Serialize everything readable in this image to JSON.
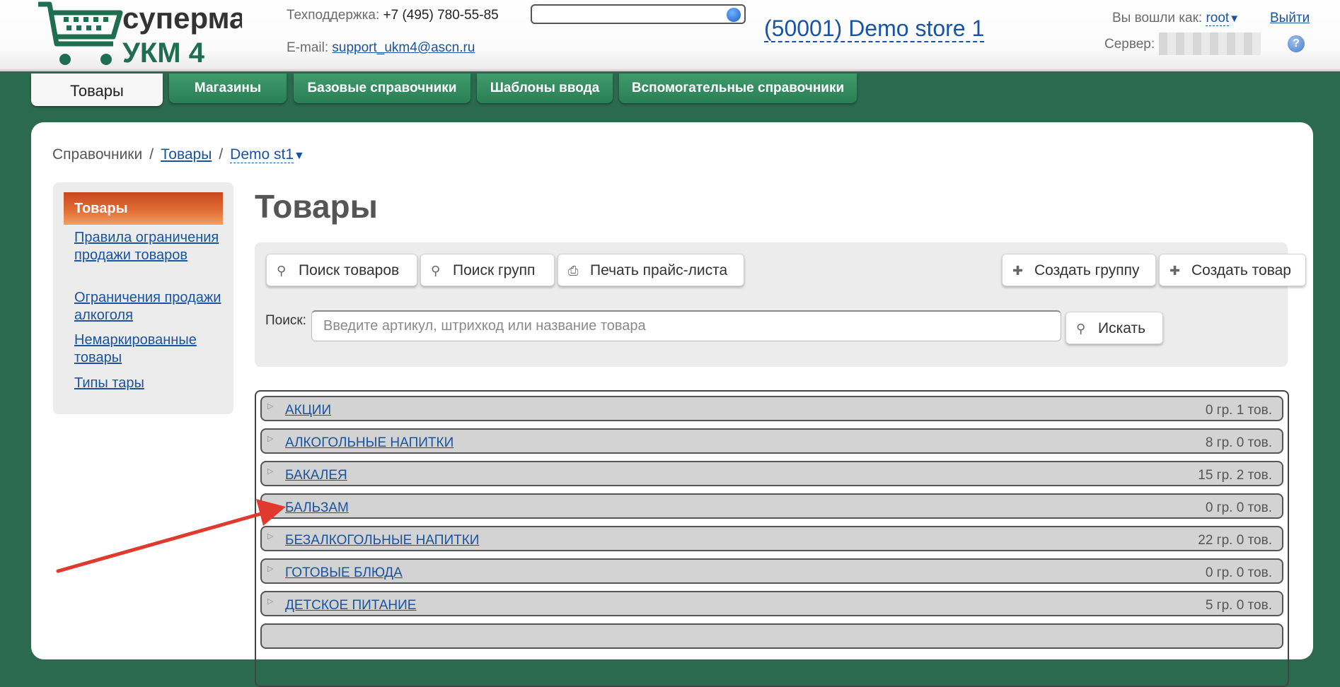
{
  "header": {
    "logo": {
      "line1": "супермаг",
      "line2": "УКМ 4"
    },
    "support_label": "Техподдержка:",
    "support_phone": "+7 (495) 780-55-85",
    "email_label": "E-mail:",
    "email": "support_ukm4@ascn.ru",
    "store_title": "(50001) Demo store 1",
    "login_label": "Вы вошли как:",
    "login_user": "root",
    "logout": "Выйти",
    "server_label": "Сервер:",
    "help": "?"
  },
  "tabs": [
    {
      "label": "Товары"
    },
    {
      "label": "Магазины"
    },
    {
      "label": "Базовые справочники"
    },
    {
      "label": "Шаблоны ввода"
    },
    {
      "label": "Вспомогательные справочники"
    }
  ],
  "breadcrumb": {
    "root": "Справочники",
    "sep": "/",
    "goods": "Товары",
    "store": "Demo st1"
  },
  "sidebar": {
    "active": "Товары",
    "links": [
      "Правила ограничения продажи товаров",
      "Ограничения продажи алкоголя",
      "Немаркированные товары",
      "Типы тары"
    ]
  },
  "page_title": "Товары",
  "toolbar": {
    "search_goods": "Поиск товаров",
    "search_groups": "Поиск групп",
    "print_price": "Печать прайс-листа",
    "create_group": "Создать группу",
    "create_goods": "Создать товар",
    "search_label": "Поиск:",
    "search_placeholder": "Введите артикул, штрихкод или название товара",
    "search_button": "Искать"
  },
  "groups": [
    {
      "name": "АКЦИИ",
      "count": "0 гр. 1 тов."
    },
    {
      "name": "АЛКОГОЛЬНЫЕ НАПИТКИ",
      "count": "8 гр. 0 тов."
    },
    {
      "name": "БАКАЛЕЯ",
      "count": "15 гр. 2 тов."
    },
    {
      "name": "БАЛЬЗАМ",
      "count": "0 гр. 0 тов."
    },
    {
      "name": "БЕЗАЛКОГОЛЬНЫЕ НАПИТКИ",
      "count": "22 гр. 0 тов."
    },
    {
      "name": "ГОТОВЫЕ БЛЮДА",
      "count": "0 гр. 0 тов."
    },
    {
      "name": "ДЕТСКОЕ ПИТАНИЕ",
      "count": "5 гр. 0 тов."
    }
  ],
  "icons": {
    "expand": "triangle-right-icon",
    "search": "magnifier-icon",
    "print": "printer-icon",
    "plus": "plus-icon"
  },
  "colors": {
    "brand_green": "#2c6a4f",
    "tab_green": "#2e8a5d",
    "active_orange": "#d9582a",
    "link_blue": "#1a53a0",
    "annotation_red": "#e03a2e"
  }
}
